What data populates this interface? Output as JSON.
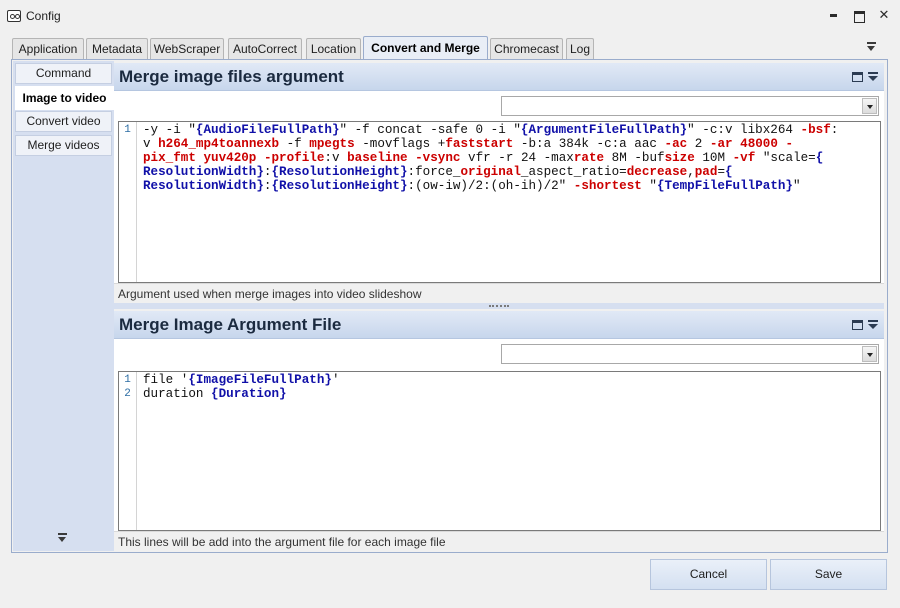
{
  "window": {
    "title": "Config"
  },
  "tabs": [
    {
      "label": "Application"
    },
    {
      "label": "Metadata"
    },
    {
      "label": "WebScraper"
    },
    {
      "label": "AutoCorrect"
    },
    {
      "label": "Location"
    },
    {
      "label": "Convert and Merge",
      "active": true
    },
    {
      "label": "Chromecast"
    },
    {
      "label": "Log"
    }
  ],
  "sidebar": {
    "items": [
      {
        "label": "Command"
      },
      {
        "label": "Image to video",
        "active": true
      },
      {
        "label": "Convert video"
      },
      {
        "label": "Merge videos"
      }
    ]
  },
  "panel1": {
    "title": "Merge image files argument",
    "combo_value": "",
    "line_numbers": [
      "1"
    ],
    "status": "Argument used when merge images into video slideshow",
    "code_lines": [
      [
        {
          "t": "-y -i \"",
          "c": "plain"
        },
        {
          "t": "{AudioFileFullPath}",
          "c": "var"
        },
        {
          "t": "\" -f concat -safe 0 -i \"",
          "c": "plain"
        },
        {
          "t": "{ArgumentFileFullPath}",
          "c": "var"
        },
        {
          "t": "\" -c:v libx264 ",
          "c": "plain"
        },
        {
          "t": "-bsf",
          "c": "red"
        },
        {
          "t": ":",
          "c": "plain"
        }
      ],
      [
        {
          "t": "v ",
          "c": "plain"
        },
        {
          "t": "h264_mp4toannexb",
          "c": "red"
        },
        {
          "t": " -f ",
          "c": "plain"
        },
        {
          "t": "mpegts",
          "c": "red"
        },
        {
          "t": " -movflags +",
          "c": "plain"
        },
        {
          "t": "faststart",
          "c": "red"
        },
        {
          "t": " -b:a 384k -c:a aac ",
          "c": "plain"
        },
        {
          "t": "-ac",
          "c": "red"
        },
        {
          "t": " 2 ",
          "c": "plain"
        },
        {
          "t": "-ar 48000 -",
          "c": "red"
        }
      ],
      [
        {
          "t": "pix_fmt yuv420p",
          "c": "red"
        },
        {
          "t": " ",
          "c": "plain"
        },
        {
          "t": "-profile",
          "c": "red"
        },
        {
          "t": ":v ",
          "c": "plain"
        },
        {
          "t": "baseline",
          "c": "red"
        },
        {
          "t": " ",
          "c": "plain"
        },
        {
          "t": "-vsync",
          "c": "red"
        },
        {
          "t": " vfr -r 24 -max",
          "c": "plain"
        },
        {
          "t": "rate",
          "c": "red"
        },
        {
          "t": " 8M -buf",
          "c": "plain"
        },
        {
          "t": "size",
          "c": "red"
        },
        {
          "t": " 10M ",
          "c": "plain"
        },
        {
          "t": "-vf",
          "c": "red"
        },
        {
          "t": " \"scale=",
          "c": "plain"
        },
        {
          "t": "{",
          "c": "var"
        }
      ],
      [
        {
          "t": "ResolutionWidth}",
          "c": "var"
        },
        {
          "t": ":",
          "c": "plain"
        },
        {
          "t": "{ResolutionHeight}",
          "c": "var"
        },
        {
          "t": ":force_",
          "c": "plain"
        },
        {
          "t": "original",
          "c": "red"
        },
        {
          "t": "_aspect_ratio=",
          "c": "plain"
        },
        {
          "t": "decrease",
          "c": "red"
        },
        {
          "t": ",",
          "c": "plain"
        },
        {
          "t": "pad",
          "c": "red"
        },
        {
          "t": "=",
          "c": "plain"
        },
        {
          "t": "{",
          "c": "var"
        }
      ],
      [
        {
          "t": "ResolutionWidth}",
          "c": "var"
        },
        {
          "t": ":",
          "c": "plain"
        },
        {
          "t": "{ResolutionHeight}",
          "c": "var"
        },
        {
          "t": ":(ow-iw)/2:(oh-ih)/2\" ",
          "c": "plain"
        },
        {
          "t": "-shortest",
          "c": "red"
        },
        {
          "t": " \"",
          "c": "plain"
        },
        {
          "t": "{TempFileFullPath}",
          "c": "var"
        },
        {
          "t": "\"",
          "c": "plain"
        }
      ]
    ]
  },
  "panel2": {
    "title": "Merge Image Argument File",
    "combo_value": "",
    "line_numbers": [
      "1",
      "2"
    ],
    "status": "This lines will be add into the argument file for each image file",
    "code_lines": [
      [
        {
          "t": "file '",
          "c": "plain"
        },
        {
          "t": "{ImageFileFullPath}",
          "c": "var"
        },
        {
          "t": "'",
          "c": "plain"
        }
      ],
      [
        {
          "t": "duration ",
          "c": "plain"
        },
        {
          "t": "{Duration}",
          "c": "var"
        }
      ]
    ]
  },
  "buttons": {
    "cancel": "Cancel",
    "save": "Save"
  },
  "colors": {
    "accent": "#c7d6ec",
    "keyword_red": "#cc0000",
    "variable_blue": "#1010a8",
    "line_number": "#2b6ca3"
  },
  "icons": [
    "app-icon",
    "minimize-icon",
    "maximize-icon",
    "close-icon",
    "tabs-menu-icon",
    "panel-maximize-icon",
    "panel-menu-icon",
    "combo-arrow-icon",
    "sidebar-menu-icon"
  ]
}
